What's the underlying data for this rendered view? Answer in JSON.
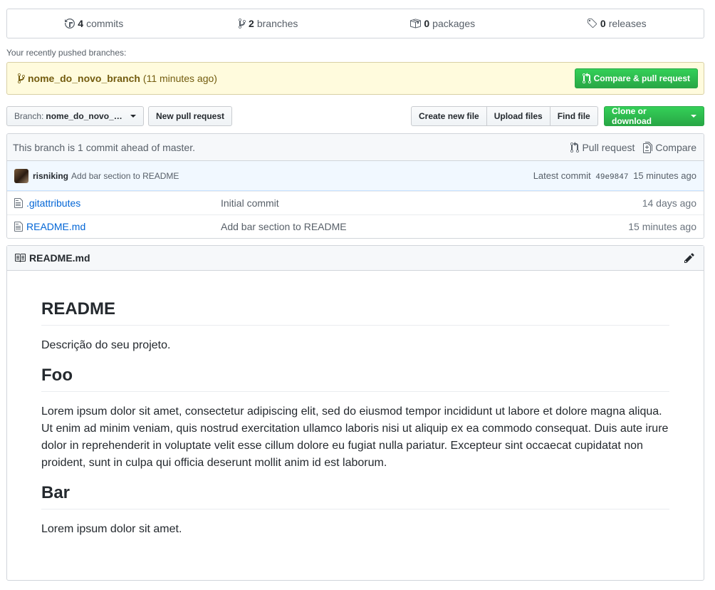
{
  "summary": {
    "commits": {
      "count": "4",
      "label": "commits",
      "icon": "history-icon"
    },
    "branches": {
      "count": "2",
      "label": "branches",
      "icon": "branch-icon"
    },
    "packages": {
      "count": "0",
      "label": "packages",
      "icon": "package-icon"
    },
    "releases": {
      "count": "0",
      "label": "releases",
      "icon": "tag-icon"
    }
  },
  "recent": {
    "label": "Your recently pushed branches:",
    "branch": "nome_do_novo_branch",
    "time": "(11 minutes ago)",
    "compare_button": "Compare & pull request"
  },
  "filenav": {
    "branch_prefix": "Branch:",
    "branch_name": "nome_do_novo_b…",
    "new_pr": "New pull request",
    "create_file": "Create new file",
    "upload_files": "Upload files",
    "find_file": "Find file",
    "clone": "Clone or download"
  },
  "branch_info": {
    "text": "This branch is 1 commit ahead of master.",
    "pull_request": "Pull request",
    "compare": "Compare"
  },
  "latest_commit": {
    "author": "risniking",
    "message": "Add bar section to README",
    "label": "Latest commit",
    "sha": "49e9847",
    "time": "15 minutes ago"
  },
  "files": [
    {
      "name": ".gitattributes",
      "message": "Initial commit",
      "age": "14 days ago"
    },
    {
      "name": "README.md",
      "message": "Add bar section to README",
      "age": "15 minutes ago"
    }
  ],
  "readme": {
    "filename": "README.md",
    "h1": "README",
    "p1": "Descrição do seu projeto.",
    "h2": "Foo",
    "p2": "Lorem ipsum dolor sit amet, consectetur adipiscing elit, sed do eiusmod tempor incididunt ut labore et dolore magna aliqua. Ut enim ad minim veniam, quis nostrud exercitation ullamco laboris nisi ut aliquip ex ea commodo consequat. Duis aute irure dolor in reprehenderit in voluptate velit esse cillum dolore eu fugiat nulla pariatur. Excepteur sint occaecat cupidatat non proident, sunt in culpa qui officia deserunt mollit anim id est laborum.",
    "h3": "Bar",
    "p3": "Lorem ipsum dolor sit amet."
  },
  "colors": {
    "accent_green": "#28a745",
    "link_blue": "#0366d6",
    "notice_bg": "#fffbdd"
  }
}
